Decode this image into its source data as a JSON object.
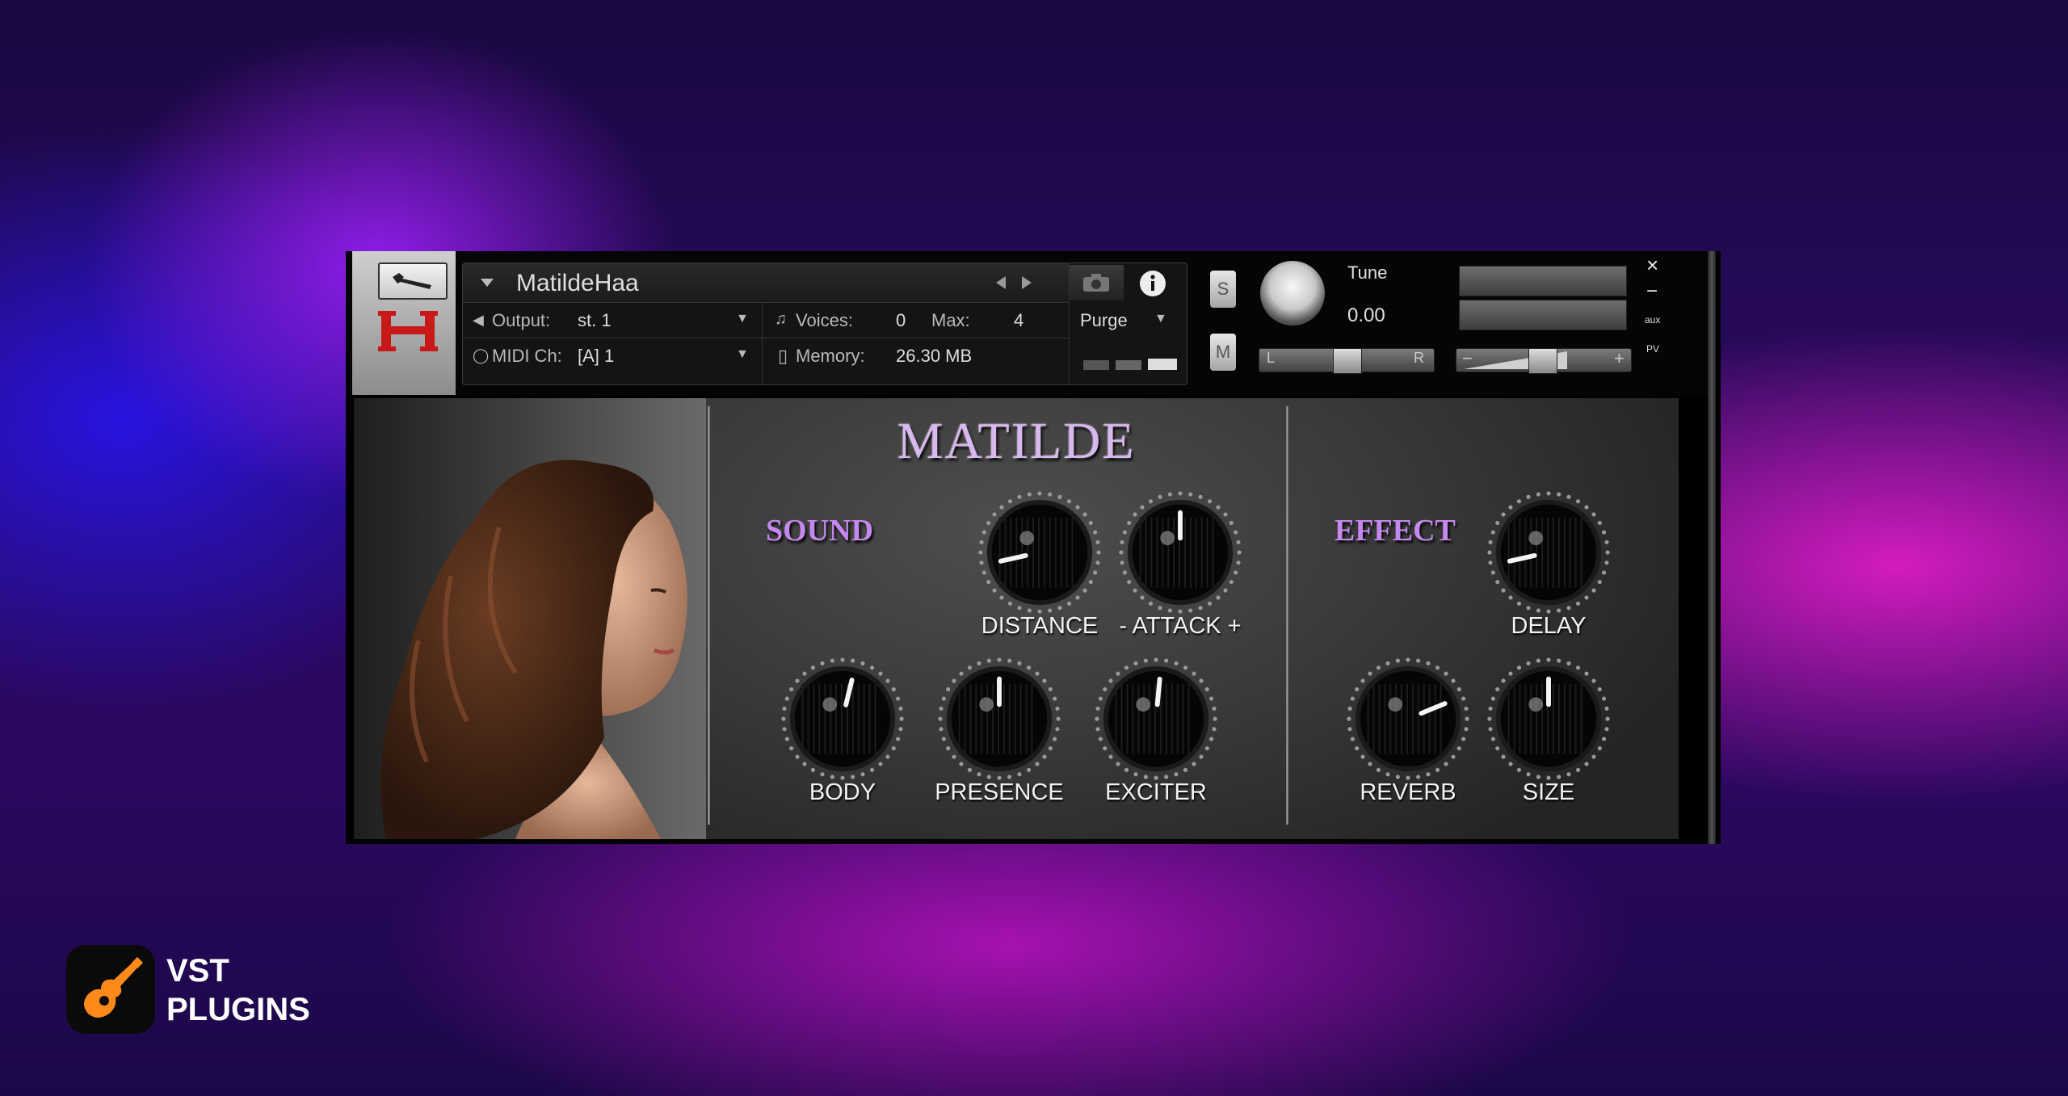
{
  "instrument": {
    "name": "MatildeHaa",
    "output_label": "Output:",
    "output_value": "st. 1",
    "midi_label": "MIDI Ch:",
    "midi_value": "[A] 1",
    "voices_label": "Voices:",
    "voices_value": "0",
    "max_label": "Max:",
    "max_value": "4",
    "memory_label": "Memory:",
    "memory_value": "26.30 MB",
    "purge_label": "Purge",
    "solo_label": "S",
    "mute_label": "M",
    "tune_label": "Tune",
    "tune_value": "0.00",
    "pan_left": "L",
    "pan_right": "R",
    "vol_minus": "−",
    "vol_plus": "+",
    "aux_label": "aux",
    "pv_label": "PV",
    "close_glyph": "×",
    "min_glyph": "−",
    "icons": [
      "wrench-icon",
      "h-logo-icon",
      "dropdown-arrow-icon",
      "prev-arrow-icon",
      "next-arrow-icon",
      "camera-icon",
      "info-icon"
    ]
  },
  "panel": {
    "title": "MATILDE",
    "sound_label": "SOUND",
    "effect_label": "EFFECT",
    "knobs": {
      "distance": {
        "label": "DISTANCE",
        "level": 0.12
      },
      "attack": {
        "label": "- ATTACK +",
        "level": 0.5
      },
      "body": {
        "label": "BODY",
        "level": 0.55
      },
      "presence": {
        "label": "PRESENCE",
        "level": 0.5
      },
      "exciter": {
        "label": "EXCITER",
        "level": 0.52
      },
      "delay": {
        "label": "DELAY",
        "level": 0.12
      },
      "reverb": {
        "label": "REVERB",
        "level": 0.75
      },
      "size": {
        "label": "SIZE",
        "level": 0.5
      }
    }
  },
  "footer": {
    "brand_line1": "VST",
    "brand_line2": "PLUGINS",
    "logo_icon": "guitar-icon"
  },
  "colors": {
    "accent_purple": "#c488ee",
    "title_lilac": "#d8b8ee",
    "logo_orange": "#ff8a1a"
  }
}
